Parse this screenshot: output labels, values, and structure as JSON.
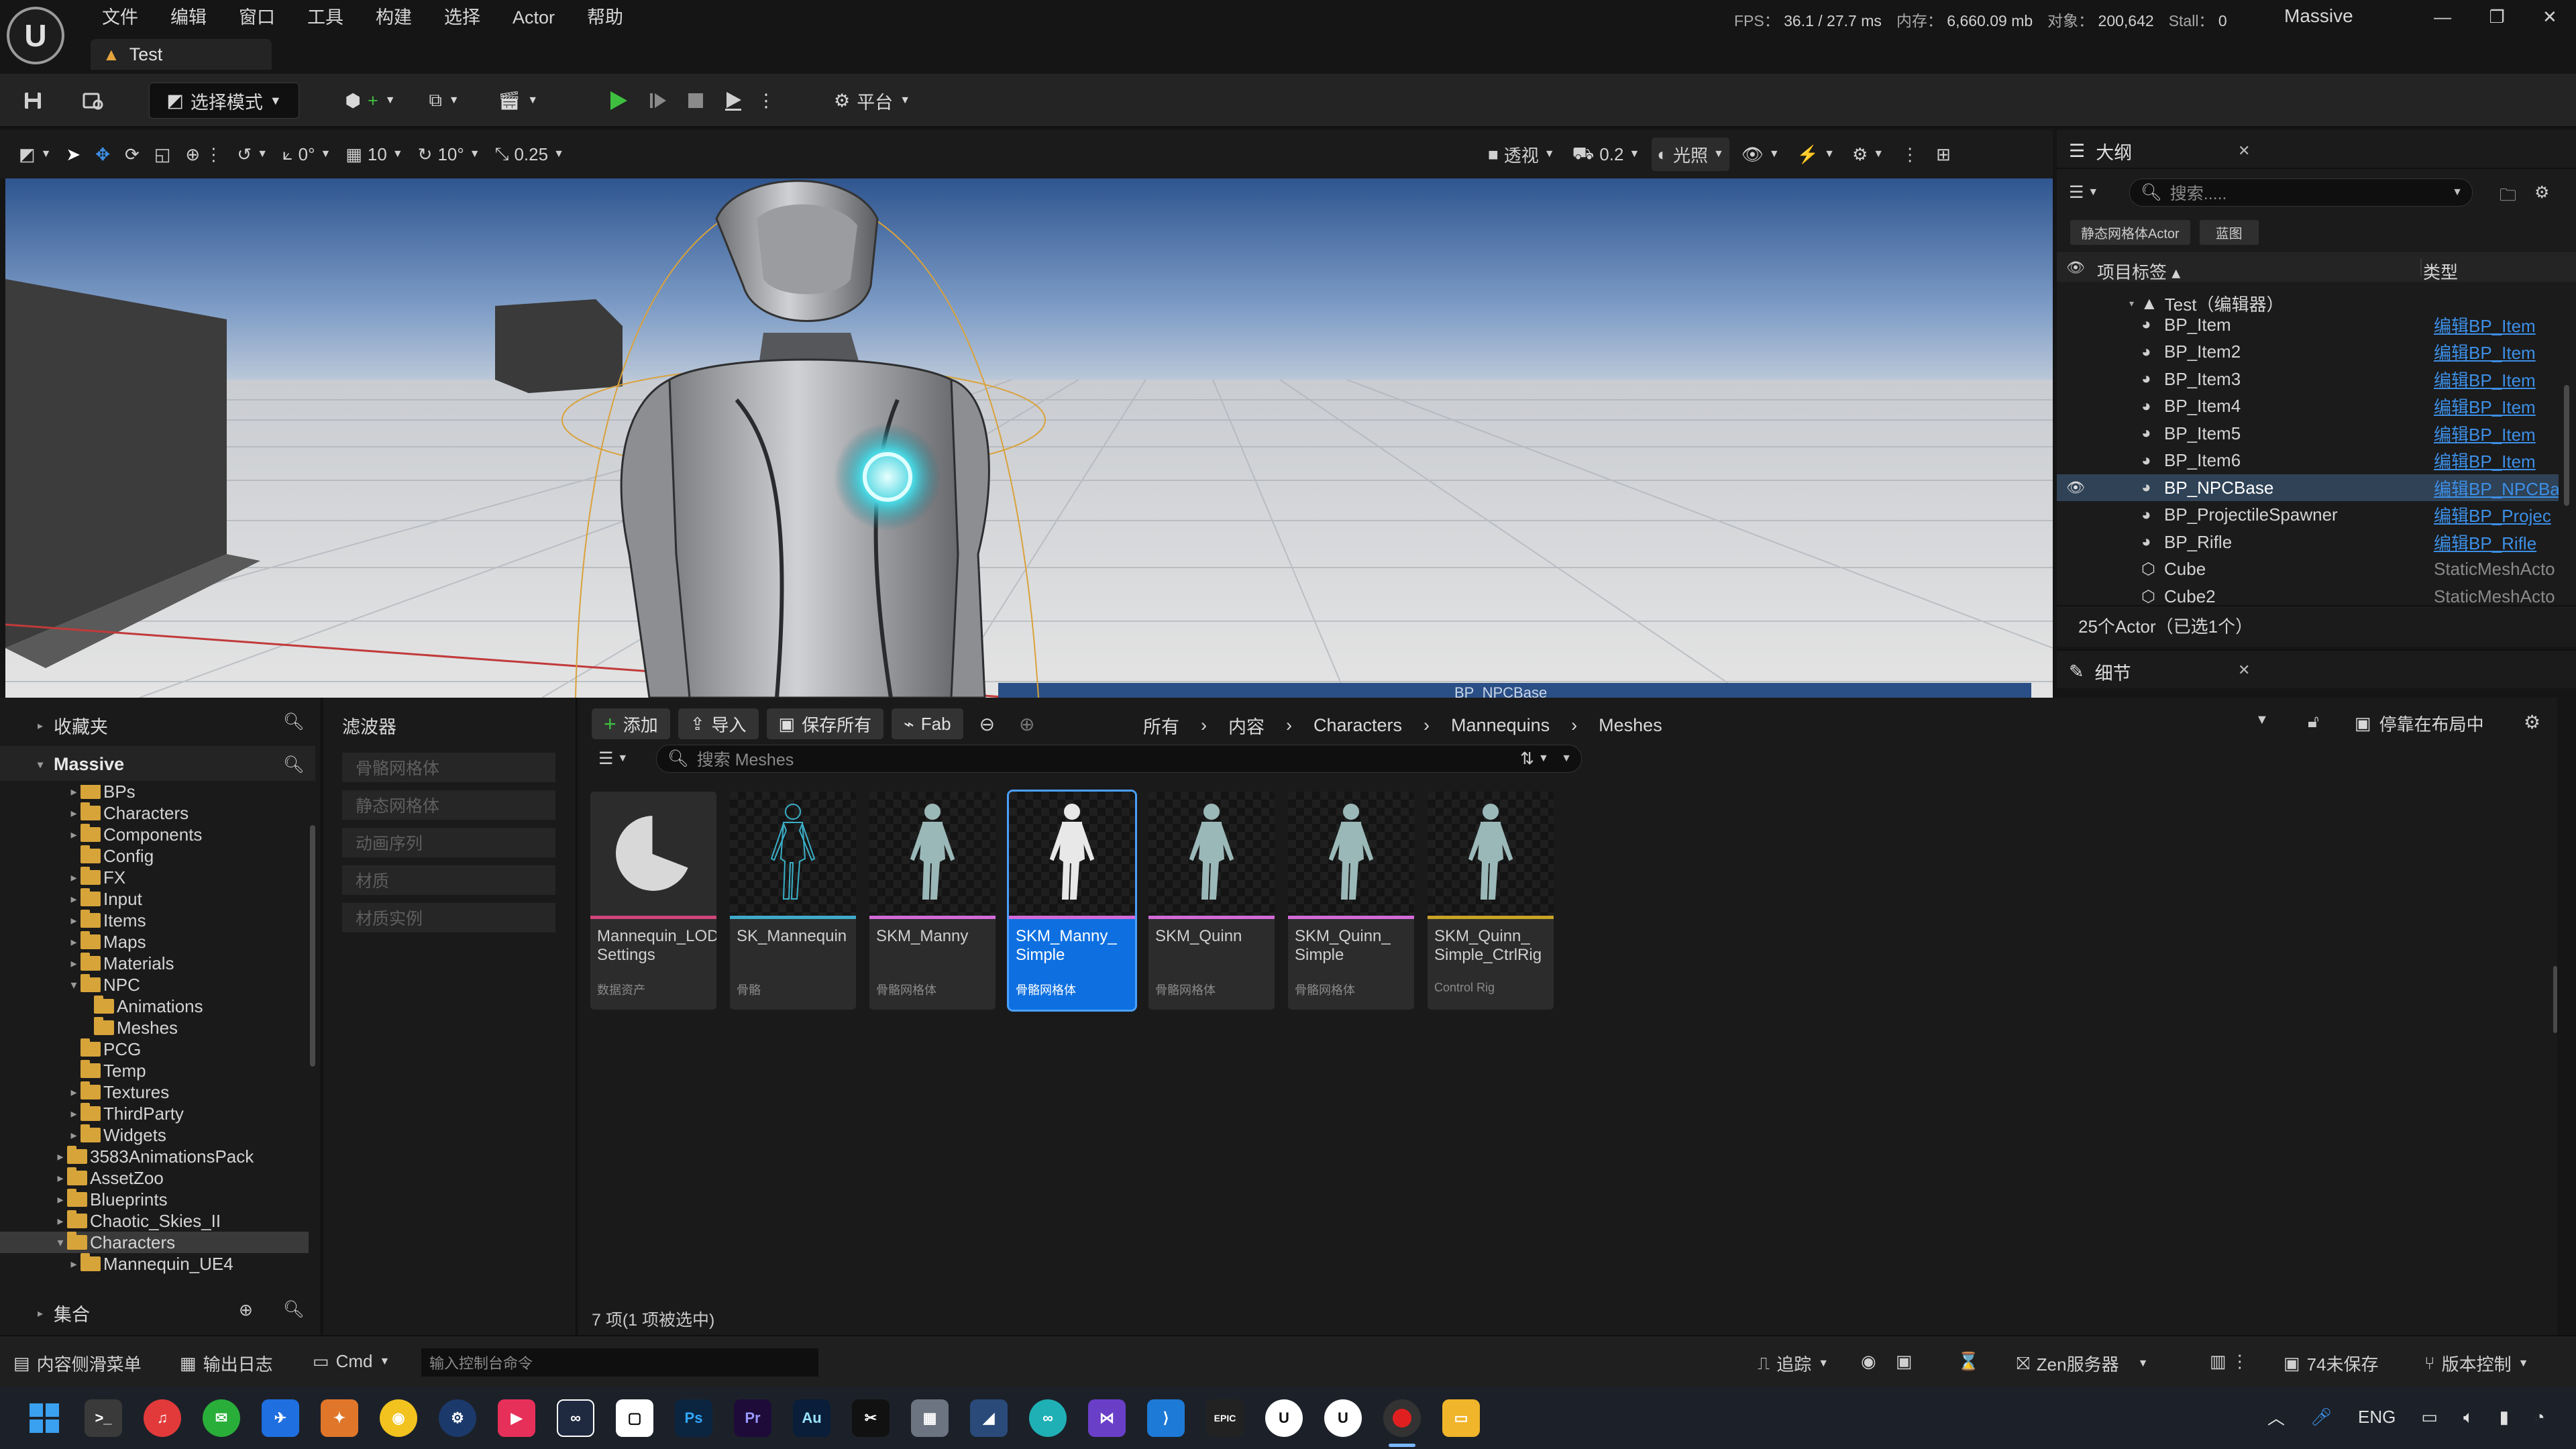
{
  "app": {
    "menu": [
      "文件",
      "编辑",
      "窗口",
      "工具",
      "构建",
      "选择",
      "Actor",
      "帮助"
    ],
    "tab_title": "Test",
    "stats": {
      "fps_label": "FPS：",
      "fps": "36.1",
      "ms": "/ 27.7 ms",
      "mem_label": "内存：",
      "mem": "6,660.09 mb",
      "obj_label": "对象：",
      "obj": "200,642",
      "stall_label": "Stall：",
      "stall": "0"
    },
    "project_name": "Massive"
  },
  "toolbar": {
    "select_mode": "选择模式",
    "platform": "平台"
  },
  "viewport_toolbar": {
    "rotate_snap": "0°",
    "grid_snap": "10",
    "angle_snap": "10°",
    "scale_snap": "0.25",
    "perspective": "透视",
    "camera_speed": "0.2",
    "lighting": "光照"
  },
  "viewport": {
    "selected_label": "BP_NPCBase"
  },
  "outliner": {
    "title": "大纲",
    "search_placeholder": "搜索.....",
    "chips": [
      "静态网格体Actor",
      "蓝图"
    ],
    "col_label": "项目标签",
    "col_type": "类型",
    "root": "Test（编辑器）",
    "rows": [
      {
        "name": "BP_Item",
        "type": "编辑BP_Item",
        "link": true
      },
      {
        "name": "BP_Item2",
        "type": "编辑BP_Item",
        "link": true
      },
      {
        "name": "BP_Item3",
        "type": "编辑BP_Item",
        "link": true
      },
      {
        "name": "BP_Item4",
        "type": "编辑BP_Item",
        "link": true
      },
      {
        "name": "BP_Item5",
        "type": "编辑BP_Item",
        "link": true
      },
      {
        "name": "BP_Item6",
        "type": "编辑BP_Item",
        "link": true
      },
      {
        "name": "BP_NPCBase",
        "type": "编辑BP_NPCBa",
        "link": true,
        "selected": true
      },
      {
        "name": "BP_ProjectileSpawner",
        "type": "编辑BP_Projec",
        "link": true
      },
      {
        "name": "BP_Rifle",
        "type": "编辑BP_Rifle",
        "link": true
      },
      {
        "name": "Cube",
        "type": "StaticMeshActo",
        "link": false
      },
      {
        "name": "Cube2",
        "type": "StaticMeshActo",
        "link": false
      }
    ],
    "count": "25个Actor（已选1个）"
  },
  "details": {
    "title": "细节"
  },
  "content_browser": {
    "favorites": "收藏夹",
    "project": "Massive",
    "collections": "集合",
    "filters_title": "滤波器",
    "filters": [
      "骨骼网格体",
      "静态网格体",
      "动画序列",
      "材质",
      "材质实例"
    ],
    "tree": [
      {
        "label": "BPs",
        "indent": 1,
        "exp": "▸"
      },
      {
        "label": "Characters",
        "indent": 1,
        "exp": "▸"
      },
      {
        "label": "Components",
        "indent": 1,
        "exp": "▸"
      },
      {
        "label": "Config",
        "indent": 1,
        "exp": ""
      },
      {
        "label": "FX",
        "indent": 1,
        "exp": "▸"
      },
      {
        "label": "Input",
        "indent": 1,
        "exp": "▸"
      },
      {
        "label": "Items",
        "indent": 1,
        "exp": "▸"
      },
      {
        "label": "Maps",
        "indent": 1,
        "exp": "▸"
      },
      {
        "label": "Materials",
        "indent": 1,
        "exp": "▸"
      },
      {
        "label": "NPC",
        "indent": 1,
        "exp": "▾"
      },
      {
        "label": "Animations",
        "indent": 2,
        "exp": ""
      },
      {
        "label": "Meshes",
        "indent": 2,
        "exp": ""
      },
      {
        "label": "PCG",
        "indent": 1,
        "exp": ""
      },
      {
        "label": "Temp",
        "indent": 1,
        "exp": ""
      },
      {
        "label": "Textures",
        "indent": 1,
        "exp": "▸"
      },
      {
        "label": "ThirdParty",
        "indent": 1,
        "exp": "▸"
      },
      {
        "label": "Widgets",
        "indent": 1,
        "exp": "▸"
      },
      {
        "label": "3583AnimationsPack",
        "indent": 0,
        "exp": "▸"
      },
      {
        "label": "AssetZoo",
        "indent": 0,
        "exp": "▸"
      },
      {
        "label": "Blueprints",
        "indent": 0,
        "exp": "▸"
      },
      {
        "label": "Chaotic_Skies_II",
        "indent": 0,
        "exp": "▸"
      },
      {
        "label": "Characters",
        "indent": 0,
        "exp": "▾",
        "selected": true
      },
      {
        "label": "Mannequin_UE4",
        "indent": 1,
        "exp": "▸"
      }
    ],
    "buttons": {
      "add": "添加",
      "import": "导入",
      "save_all": "保存所有",
      "fab": "Fab"
    },
    "breadcrumb": [
      "所有",
      "内容",
      "Characters",
      "Mannequins",
      "Meshes"
    ],
    "dock": "停靠在布局中",
    "search_placeholder": "搜索 Meshes",
    "assets": [
      {
        "name": "Mannequin_LOD Settings",
        "type": "数据资产",
        "bar": "#d0457a",
        "kind": "pie"
      },
      {
        "name": "SK_Mannequin",
        "type": "骨骼",
        "bar": "#3fa9c9",
        "kind": "skel"
      },
      {
        "name": "SKM_Manny",
        "type": "骨骼网格体",
        "bar": "#d36ad8",
        "kind": "mesh"
      },
      {
        "name": "SKM_Manny_ Simple",
        "type": "骨骼网格体",
        "bar": "#d36ad8",
        "kind": "white",
        "selected": true
      },
      {
        "name": "SKM_Quinn",
        "type": "骨骼网格体",
        "bar": "#d36ad8",
        "kind": "mesh"
      },
      {
        "name": "SKM_Quinn_ Simple",
        "type": "骨骼网格体",
        "bar": "#d36ad8",
        "kind": "mesh"
      },
      {
        "name": "SKM_Quinn_ Simple_CtrlRig",
        "type": "Control Rig",
        "bar": "#c9a227",
        "kind": "mesh"
      }
    ],
    "status": "7 项(1 项被选中)"
  },
  "statusbar": {
    "drawer": "内容侧滑菜单",
    "output_log": "输出日志",
    "cmd": "Cmd",
    "console_placeholder": "输入控制台命令",
    "trace": "追踪",
    "zen": "Zen服务器",
    "unsaved": "74未保存",
    "revision": "版本控制"
  },
  "taskbar": {
    "lang": "ENG",
    "icons": [
      "windows-start",
      "terminal",
      "netease-music",
      "wechat",
      "feishu",
      "vpn",
      "chrome",
      "steam",
      "app-red",
      "meta",
      "roblox",
      "photoshop",
      "premiere",
      "audition",
      "capcut",
      "calculator",
      "wireshark",
      "bilibili",
      "visual-studio",
      "vscode",
      "epic",
      "unreal",
      "unreal-2",
      "obs",
      "explorer"
    ]
  },
  "colors": {
    "accent": "#0e70e0",
    "link": "#3d8fe6",
    "play": "#3fbf3f"
  }
}
